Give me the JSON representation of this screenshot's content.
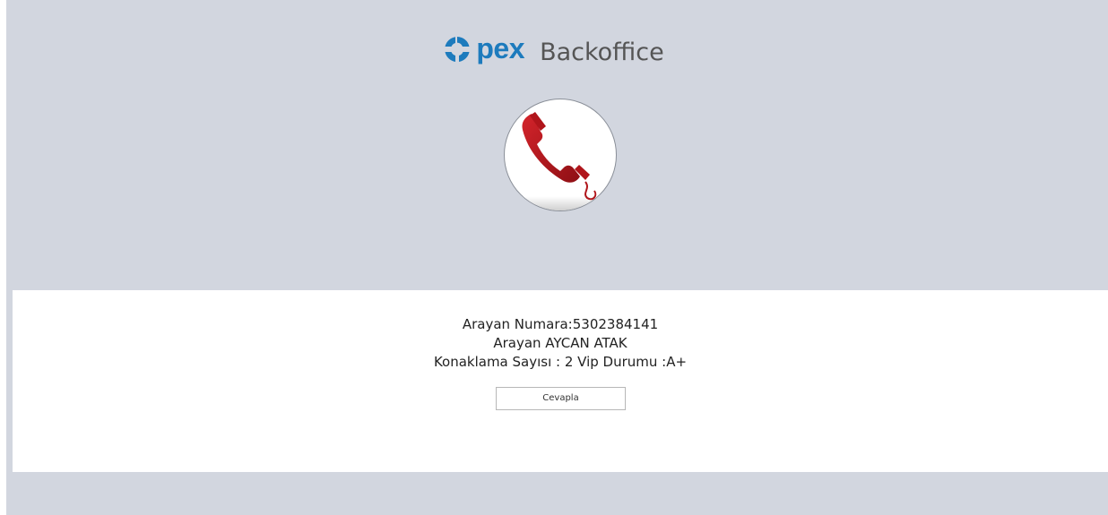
{
  "brand": {
    "logo_mark": "Opex",
    "logo_text_colored": "pex",
    "app_name": "Backoffice",
    "brand_color": "#1d7bbd"
  },
  "call_icon": {
    "icon": "phone-handset-icon",
    "color": "#b0151b"
  },
  "caller": {
    "number_line": "Arayan Numara:5302384141",
    "name_line": "Arayan AYCAN ATAK",
    "stay_line": "Konaklama Sayısı : 2 Vip Durumu :A+"
  },
  "actions": {
    "answer_label": "Cevapla"
  },
  "colors": {
    "background": "#d2d6df",
    "panel": "#ffffff"
  }
}
